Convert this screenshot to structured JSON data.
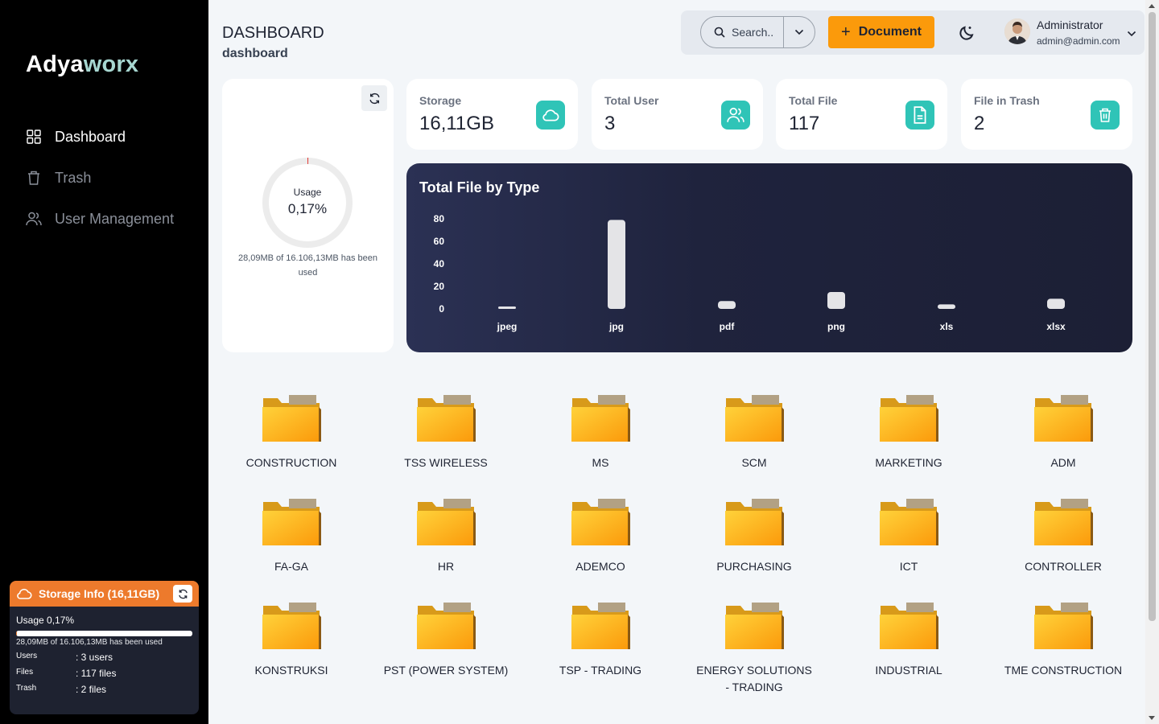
{
  "brand": {
    "part1": "Adya",
    "part2": "worx"
  },
  "sidebar": {
    "items": [
      {
        "label": "Dashboard",
        "icon": "grid-icon",
        "active": true
      },
      {
        "label": "Trash",
        "icon": "trash-icon",
        "active": false
      },
      {
        "label": "User Management",
        "icon": "users-icon",
        "active": false
      }
    ]
  },
  "storage_info": {
    "title": "Storage Info (16,11GB)",
    "usage": "Usage 0,17%",
    "usage_fraction": 0.0017,
    "used_text": "28,09MB of 16.106,13MB has been used",
    "rows": [
      {
        "key": "Users",
        "value": ": 3 users"
      },
      {
        "key": "Files",
        "value": ": 117 files"
      },
      {
        "key": "Trash",
        "value": ": 2 files"
      }
    ]
  },
  "header": {
    "title": "DASHBOARD",
    "subtitle": "dashboard"
  },
  "topbar": {
    "search_label": "Search..",
    "document_button": "Document",
    "user_name": "Administrator",
    "user_email": "admin@admin.com"
  },
  "usage_card": {
    "label": "Usage",
    "value": "0,17%",
    "fraction": 0.0017,
    "text": "28,09MB of 16.106,13MB has been used"
  },
  "stats": [
    {
      "label": "Storage",
      "value": "16,11GB",
      "icon": "cloud-icon"
    },
    {
      "label": "Total User",
      "value": "3",
      "icon": "users-icon"
    },
    {
      "label": "Total File",
      "value": "117",
      "icon": "file-icon"
    },
    {
      "label": "File in Trash",
      "value": "2",
      "icon": "trash-icon"
    }
  ],
  "chart_data": {
    "type": "bar",
    "title": "Total File by Type",
    "categories": [
      "jpeg",
      "jpg",
      "pdf",
      "png",
      "xls",
      "xlsx"
    ],
    "values": [
      1,
      79,
      7,
      15,
      4,
      9
    ],
    "yticks": [
      0,
      20,
      40,
      60,
      80
    ],
    "ylim": [
      0,
      80
    ],
    "grid": false,
    "xlabel": "",
    "ylabel": ""
  },
  "folders": [
    "CONSTRUCTION",
    "TSS WIRELESS",
    "MS",
    "SCM",
    "MARKETING",
    "ADM",
    "FA-GA",
    "HR",
    "ADEMCO",
    "PURCHASING",
    "ICT",
    "CONTROLLER",
    "KONSTRUKSI",
    "PST (POWER SYSTEM)",
    "TSP - TRADING",
    "ENERGY SOLUTIONS - TRADING",
    "INDUSTRIAL",
    "TME CONSTRUCTION"
  ],
  "colors": {
    "accent": "#fb9a0b",
    "teal": "#2fc4b7",
    "storage_orange": "#ed7a2c",
    "chart_bg": "#1f233d"
  }
}
